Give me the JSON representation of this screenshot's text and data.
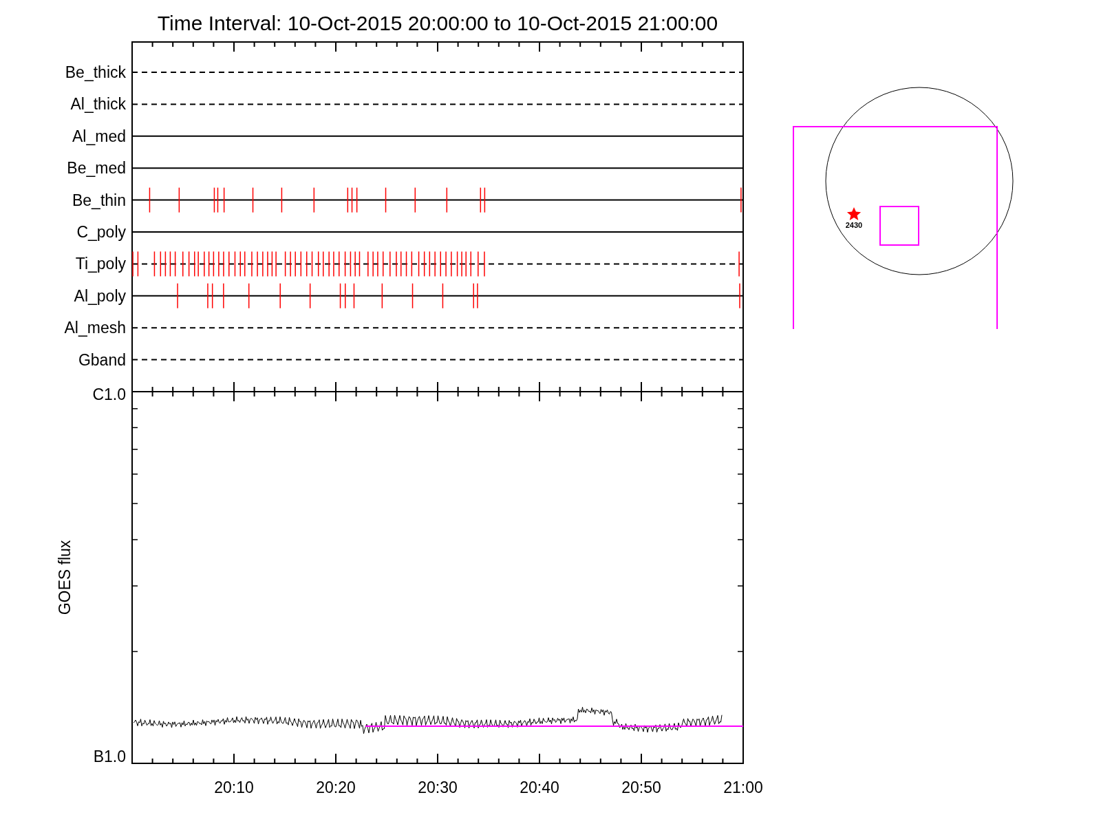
{
  "title": "Time Interval: 10-Oct-2015 20:00:00 to 10-Oct-2015 21:00:00",
  "filter_panel": {
    "rows": [
      {
        "name": "Be_thick",
        "kind": "dashed"
      },
      {
        "name": "Al_thick",
        "kind": "dashed"
      },
      {
        "name": "Al_med",
        "kind": "solid"
      },
      {
        "name": "Be_med",
        "kind": "solid"
      },
      {
        "name": "Be_thin",
        "kind": "solid"
      },
      {
        "name": "C_poly",
        "kind": "solid"
      },
      {
        "name": "Ti_poly",
        "kind": "dashed"
      },
      {
        "name": "Al_poly",
        "kind": "solid"
      },
      {
        "name": "Al_mesh",
        "kind": "dashed"
      },
      {
        "name": "Gband",
        "kind": "dashed"
      }
    ]
  },
  "flux_panel": {
    "ylabel": "GOES flux",
    "ytick_top": "C1.0",
    "ytick_bottom": "B1.0",
    "xtick_labels": [
      "20:10",
      "20:20",
      "20:30",
      "20:40",
      "20:50",
      "21:00"
    ]
  },
  "sun_inset": {
    "region_label": "2430"
  }
}
